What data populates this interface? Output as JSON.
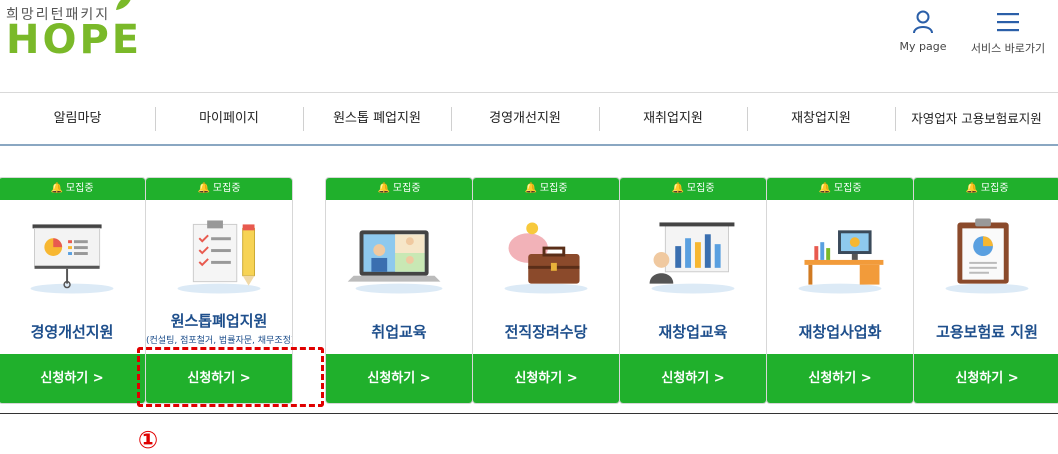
{
  "logo": {
    "subtitle": "희망리턴패키지",
    "brand": "HOPE"
  },
  "header": {
    "mypage_label": "My page",
    "service_label": "서비스 바로가기"
  },
  "nav": {
    "items": [
      {
        "label": "알림마당"
      },
      {
        "label": "마이페이지"
      },
      {
        "label": "원스톱 폐업지원"
      },
      {
        "label": "경영개선지원"
      },
      {
        "label": "재취업지원"
      },
      {
        "label": "재창업지원"
      },
      {
        "label": "자영업자 고용보험료지원"
      }
    ]
  },
  "cards": [
    {
      "badge": "모집중",
      "title": "경영개선지원",
      "subtitle": "",
      "apply": "신청하기 >",
      "icon": "presentation-board-icon"
    },
    {
      "badge": "모집중",
      "title": "원스톱폐업지원",
      "subtitle": "(컨설팅, 점포철거, 법률자문, 채무조정)",
      "apply": "신청하기 >",
      "icon": "checklist-clipboard-icon"
    },
    {
      "badge": "모집중",
      "title": "취업교육",
      "subtitle": "",
      "apply": "신청하기 >",
      "icon": "video-call-laptop-icon"
    },
    {
      "badge": "모집중",
      "title": "전직장려수당",
      "subtitle": "",
      "apply": "신청하기 >",
      "icon": "piggy-bank-briefcase-icon"
    },
    {
      "badge": "모집중",
      "title": "재창업교육",
      "subtitle": "",
      "apply": "신청하기 >",
      "icon": "presenter-bar-chart-icon"
    },
    {
      "badge": "모집중",
      "title": "재창업사업화",
      "subtitle": "",
      "apply": "신청하기 >",
      "icon": "desk-monitor-icon"
    },
    {
      "badge": "모집중",
      "title": "고용보험료 지원",
      "subtitle": "",
      "apply": "신청하기 >",
      "icon": "pie-chart-clipboard-icon"
    }
  ],
  "annotation": {
    "marker": "①",
    "color": "#e00000"
  },
  "colors": {
    "brand_green": "#20b02c",
    "logo_green": "#7ab929",
    "title_blue": "#1e4f8c"
  }
}
